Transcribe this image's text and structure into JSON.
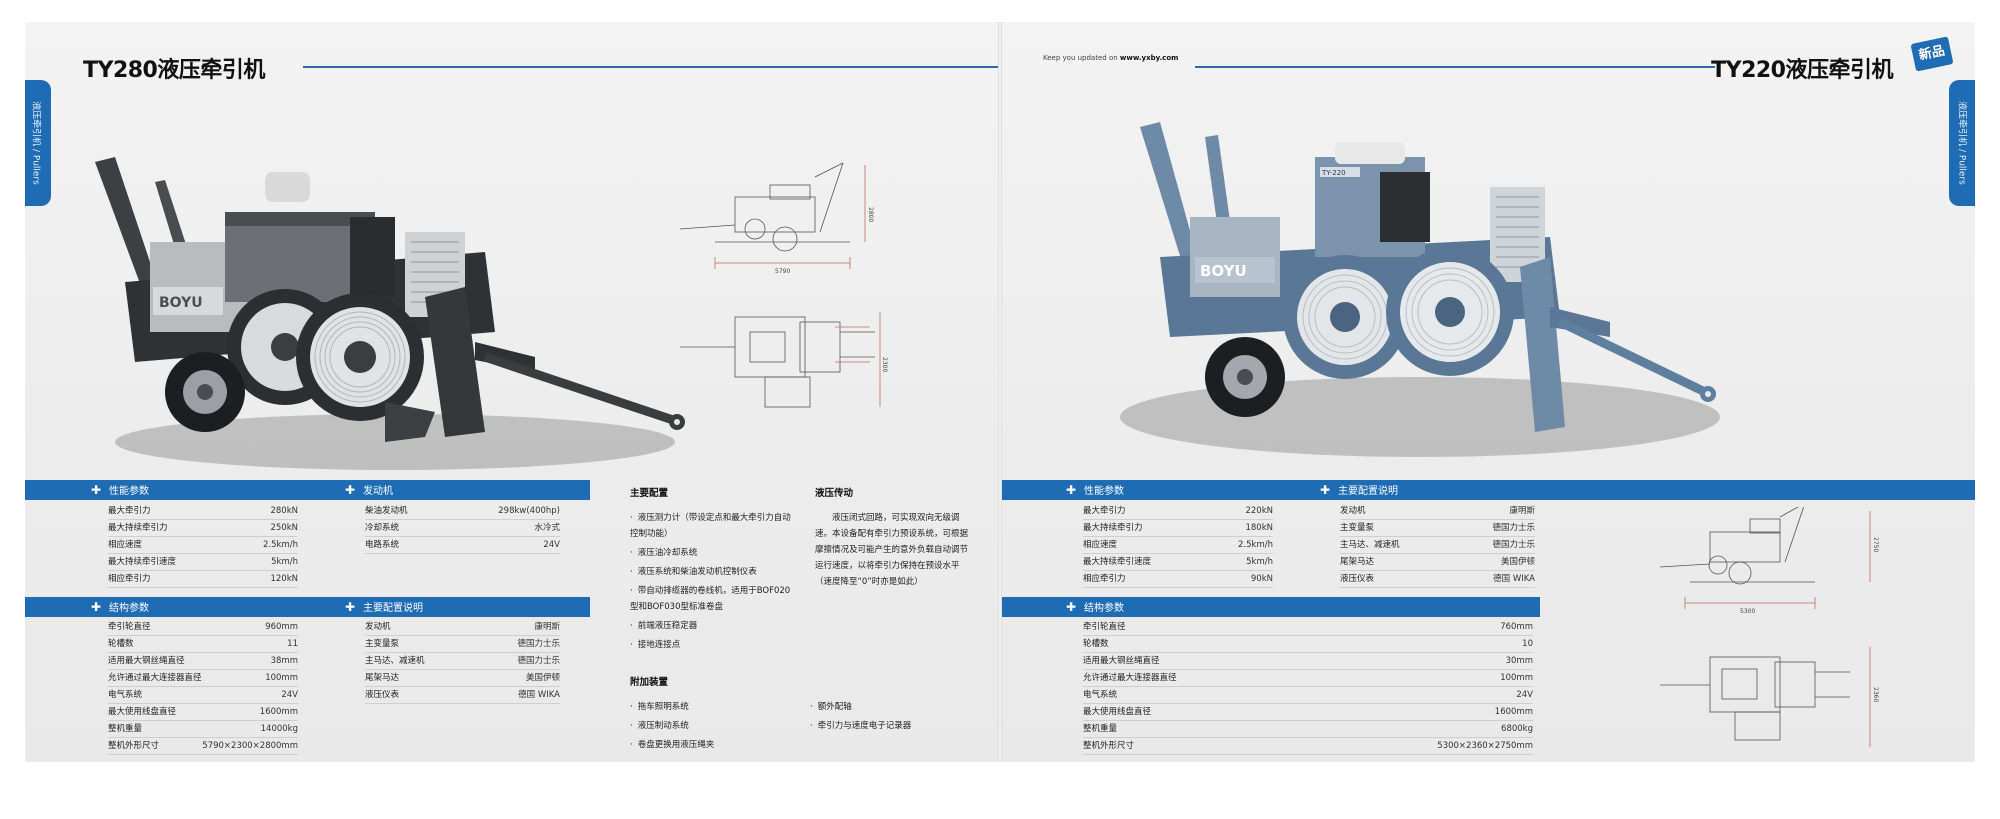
{
  "left_page": {
    "title": "TY280液压牵引机",
    "side_tab": "液压牵引机 / Pullers",
    "performance": {
      "header": "性能参数",
      "rows": [
        {
          "k": "最大牵引力",
          "v": "280kN"
        },
        {
          "k": "最大持续牵引力",
          "v": "250kN"
        },
        {
          "k": "相应速度",
          "v": "2.5km/h"
        },
        {
          "k": "最大持续牵引速度",
          "v": "5km/h"
        },
        {
          "k": "相应牵引力",
          "v": "120kN"
        }
      ]
    },
    "engine": {
      "header": "发动机",
      "rows": [
        {
          "k": "柴油发动机",
          "v": "298kw(400hp)"
        },
        {
          "k": "冷却系统",
          "v": "水冷式"
        },
        {
          "k": "电路系统",
          "v": "24V"
        }
      ]
    },
    "structure": {
      "header": "结构参数",
      "rows": [
        {
          "k": "牵引轮直径",
          "v": "960mm"
        },
        {
          "k": "轮槽数",
          "v": "11"
        },
        {
          "k": "适用最大钢丝绳直径",
          "v": "38mm"
        },
        {
          "k": "允许通过最大连接器直径",
          "v": "100mm"
        },
        {
          "k": "电气系统",
          "v": "24V"
        },
        {
          "k": "最大使用线盘直径",
          "v": "1600mm"
        },
        {
          "k": "整机重量",
          "v": "14000kg"
        },
        {
          "k": "整机外形尺寸",
          "v": "5790×2300×2800mm"
        }
      ]
    },
    "main_config": {
      "header": "主要配置说明",
      "rows": [
        {
          "k": "发动机",
          "v": "康明斯"
        },
        {
          "k": "主变量泵",
          "v": "德国力士乐"
        },
        {
          "k": "主马达、减速机",
          "v": "德国力士乐"
        },
        {
          "k": "尾架马达",
          "v": "美国伊顿"
        },
        {
          "k": "液压仪表",
          "v": "德国 WIKA"
        }
      ]
    },
    "middle": {
      "config_title": "主要配置",
      "config_items": [
        "液压测力计（带设定点和最大牵引力自动控制功能）",
        "液压油冷却系统",
        "液压系统和柴油发动机控制仪表",
        "带自动排缆器的卷线机，适用于BOF020型和BOF030型标准卷盘",
        "前端液压稳定器",
        "接地连接点"
      ],
      "hydraulic_title": "液压传动",
      "hydraulic_text": "液压闭式回路，可实现双向无级调速。本设备配有牵引力预设系统，可根据摩擦情况及可能产生的意外负载自动调节运行速度，以将牵引力保持在预设水平（速度降至“0”时亦是如此）",
      "extra_title": "附加装置",
      "extra_items_left": [
        "拖车照明系统",
        "液压制动系统",
        "卷盘更换用液压绳夹"
      ],
      "extra_items_right": [
        "额外配轴",
        "牵引力与速度电子记录器"
      ]
    },
    "drawing_dims": {
      "length": "5790",
      "height": "2800",
      "width": "2300"
    }
  },
  "right_page": {
    "title": "TY220液压牵引机",
    "side_tab": "液压牵引机 / Pullers",
    "badge": "新品",
    "tagline_prefix": "Keep you updated on",
    "tagline_url": "www.yxby.com",
    "performance": {
      "header": "性能参数",
      "rows": [
        {
          "k": "最大牵引力",
          "v": "220kN"
        },
        {
          "k": "最大持续牵引力",
          "v": "180kN"
        },
        {
          "k": "相应速度",
          "v": "2.5km/h"
        },
        {
          "k": "最大持续牵引速度",
          "v": "5km/h"
        },
        {
          "k": "相应牵引力",
          "v": "90kN"
        }
      ]
    },
    "main_config": {
      "header": "主要配置说明",
      "rows": [
        {
          "k": "发动机",
          "v": "康明斯"
        },
        {
          "k": "主变量泵",
          "v": "德国力士乐"
        },
        {
          "k": "主马达、减速机",
          "v": "德国力士乐"
        },
        {
          "k": "尾架马达",
          "v": "美国伊顿"
        },
        {
          "k": "液压仪表",
          "v": "德国 WIKA"
        }
      ]
    },
    "structure": {
      "header": "结构参数",
      "rows": [
        {
          "k": "牵引轮直径",
          "v": "760mm"
        },
        {
          "k": "轮槽数",
          "v": "10"
        },
        {
          "k": "适用最大钢丝绳直径",
          "v": "30mm"
        },
        {
          "k": "允许通过最大连接器直径",
          "v": "100mm"
        },
        {
          "k": "电气系统",
          "v": "24V"
        },
        {
          "k": "最大使用线盘直径",
          "v": "1600mm"
        },
        {
          "k": "整机重量",
          "v": "6800kg"
        },
        {
          "k": "整机外形尺寸",
          "v": "5300×2360×2750mm"
        }
      ]
    },
    "drawing_dims": {
      "length": "5300",
      "height": "2750",
      "width": "2360"
    }
  },
  "colors": {
    "accent": "#1e6cb4",
    "machine_left": "#3a3d40",
    "machine_right": "#5f7f9f"
  },
  "icons": {
    "section": "plus-icon"
  }
}
